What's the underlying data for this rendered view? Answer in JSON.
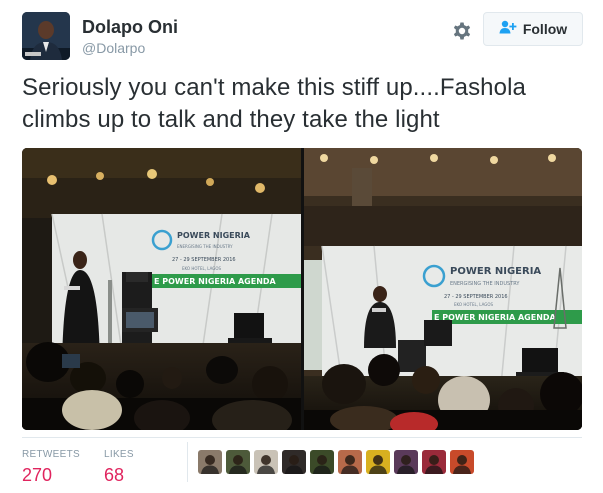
{
  "user": {
    "display_name": "Dolapo Oni",
    "handle": "@Dolarpo"
  },
  "actions": {
    "follow_label": "Follow",
    "settings_icon": "gear-icon",
    "follow_icon": "add-user-icon"
  },
  "tweet": {
    "text": "Seriously you can't make this stiff up....Fashola climbs up to talk and they take the light"
  },
  "media": {
    "banner_left": {
      "title": "POWER NIGERIA",
      "tagline": "ENERGISING THE INDUSTRY",
      "dates": "27 - 29 SEPTEMBER 2016",
      "venue": "EKO HOTEL, LAGOS",
      "strip": "E POWER NIGERIA AGENDA"
    },
    "banner_right": {
      "title": "POWER NIGERIA",
      "tagline": "ENERGISING THE INDUSTRY",
      "dates": "27 - 29 SEPTEMBER 2016",
      "venue": "EKO HOTEL, LAGOS",
      "strip": "E POWER NIGERIA AGENDA"
    }
  },
  "stats": {
    "retweets_label": "RETWEETS",
    "retweets_value": "270",
    "likes_label": "LIKES",
    "likes_value": "68"
  },
  "likers": [
    {
      "color": "#8a7a6a"
    },
    {
      "color": "#4d5a3a"
    },
    {
      "color": "#c9c2b6"
    },
    {
      "color": "#2f2a28"
    },
    {
      "color": "#3b4a28"
    },
    {
      "color": "#b86a4a"
    },
    {
      "color": "#d8b020"
    },
    {
      "color": "#5a3a5a"
    },
    {
      "color": "#9a2a3a"
    },
    {
      "color": "#c84a2a"
    }
  ],
  "colors": {
    "accent": "#e0245e",
    "muted": "#8899a6",
    "text": "#292f33",
    "border": "#e1e8ed"
  }
}
